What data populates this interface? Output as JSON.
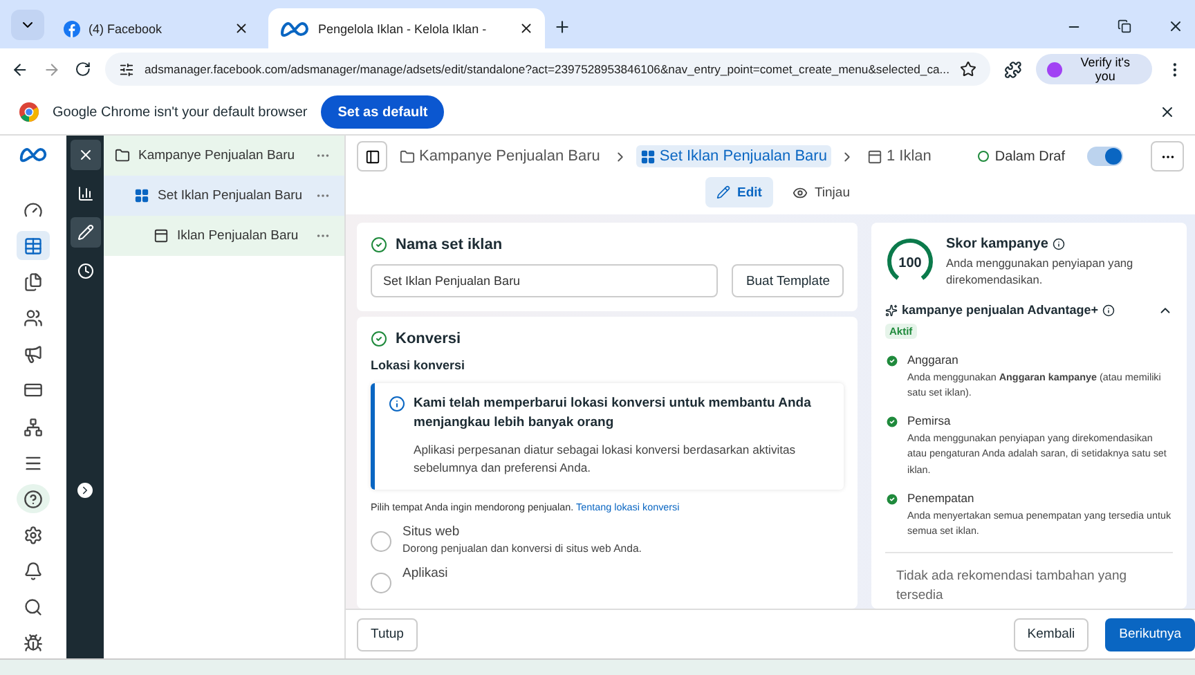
{
  "browser": {
    "tabs": [
      {
        "title": "(4) Facebook",
        "kind": "facebook",
        "selected": false
      },
      {
        "title": "Pengelola Iklan - Kelola Iklan -",
        "kind": "meta",
        "selected": true
      }
    ],
    "url": "adsmanager.facebook.com/adsmanager/manage/adsets/edit/standalone?act=2397528953846106&nav_entry_point=comet_create_menu&selected_ca...",
    "profile_button": "Verify it's you"
  },
  "infobar": {
    "message": "Google Chrome isn't your default browser",
    "button": "Set as default"
  },
  "nav_rail": [
    {
      "kind": "gauge",
      "selected": false
    },
    {
      "kind": "table",
      "selected": true
    },
    {
      "kind": "pages",
      "selected": false
    },
    {
      "kind": "people",
      "selected": false
    },
    {
      "kind": "megaphone",
      "selected": false
    },
    {
      "kind": "card",
      "selected": false
    },
    {
      "kind": "network",
      "selected": false
    },
    {
      "kind": "menu",
      "selected": false
    },
    {
      "kind": "help",
      "selected": false
    },
    {
      "kind": "gear",
      "selected": false
    },
    {
      "kind": "bell",
      "selected": false
    },
    {
      "kind": "search",
      "selected": false
    },
    {
      "kind": "bug",
      "selected": false
    }
  ],
  "tool_rail": [
    {
      "kind": "close",
      "selected": true
    },
    {
      "kind": "chart",
      "selected": false
    },
    {
      "kind": "pencil",
      "selected": true
    },
    {
      "kind": "clock",
      "selected": false
    },
    {
      "kind": "expand",
      "selected": false
    }
  ],
  "tree": [
    {
      "label": "Kampanye Penjualan Baru",
      "kind": "campaign",
      "selected": false,
      "children": [
        {
          "label": "Set Iklan Penjualan Baru",
          "kind": "adset",
          "selected": true,
          "children": [
            {
              "label": "Iklan Penjualan Baru",
              "kind": "ad",
              "selected": false
            }
          ]
        }
      ]
    }
  ],
  "breadcrumb": [
    {
      "label": "Kampanye Penjualan Baru",
      "kind": "campaign",
      "selected": false
    },
    {
      "label": "Set Iklan Penjualan Baru",
      "kind": "adset",
      "selected": true
    },
    {
      "label": "1 Iklan",
      "kind": "ad",
      "selected": false
    }
  ],
  "status": "Dalam Draf",
  "toggle": {
    "on": true
  },
  "mode_tabs": [
    {
      "label": "Edit",
      "kind": "pencil",
      "selected": true
    },
    {
      "label": "Tinjau",
      "kind": "eye",
      "selected": false
    }
  ],
  "name_section": {
    "title": "Nama set iklan",
    "value": "Set Iklan Penjualan Baru",
    "button": "Buat Template"
  },
  "conversion_section": {
    "title": "Konversi",
    "subtitle": "Lokasi konversi",
    "notice": {
      "title": "Kami telah memperbarui lokasi konversi untuk membantu Anda menjangkau lebih banyak orang",
      "body": "Aplikasi perpesanan diatur sebagai lokasi konversi berdasarkan aktivitas sebelumnya dan preferensi Anda."
    },
    "prompt": "Pilih tempat Anda ingin mendorong penjualan.",
    "link": "Tentang lokasi konversi",
    "options": [
      {
        "label": "Situs web",
        "description": "Dorong penjualan dan konversi di situs web Anda.",
        "selected": false
      },
      {
        "label": "Aplikasi",
        "selected": false
      }
    ]
  },
  "score_card": {
    "score": "100",
    "title": "Skor kampanye",
    "description": "Anda menggunakan penyiapan yang direkomendasikan.",
    "advantage": {
      "title": "kampanye penjualan Advantage+",
      "badge": "Aktif",
      "expanded": true
    },
    "checks": [
      {
        "title": "Anggaran",
        "text": "Anda menggunakan **Anggaran kampanye** (atau memiliki satu set iklan).",
        "done": true
      },
      {
        "title": "Pemirsa",
        "text": "Anda menggunakan penyiapan yang direkomendasikan atau pengaturan Anda adalah saran, di setidaknya satu set iklan.",
        "done": true
      },
      {
        "title": "Penempatan",
        "text": "Anda menyertakan semua penempatan yang tersedia untuk semua set iklan.",
        "done": true
      }
    ],
    "footer": "Tidak ada rekomendasi tambahan yang tersedia"
  },
  "footer_buttons": {
    "close": "Tutup",
    "back": "Kembali",
    "next": "Berikutnya"
  }
}
